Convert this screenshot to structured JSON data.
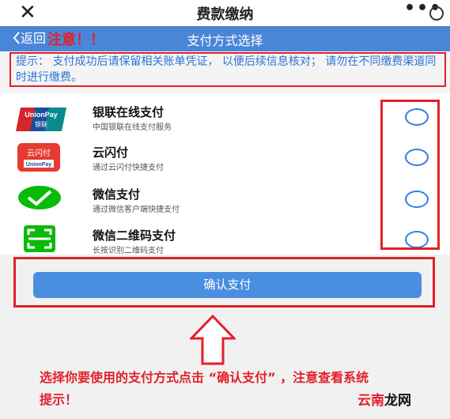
{
  "topbar": {
    "title": "费款缴纳",
    "close_glyph": "✕",
    "more_glyph": "•••"
  },
  "navbar": {
    "back_label": "返回",
    "title": "支付方式选择",
    "note": "注意！！"
  },
  "notice": {
    "text": "提示：  支付成功后请保留相关账单凭证，  以便后续信息核对；  请勿在不同缴费渠道同时进行缴费。"
  },
  "methods": [
    {
      "name": "银联在线支付",
      "desc": "中国银联在线支付服务",
      "icon": "unionpay-logo",
      "logo_text_top": "UnionPay",
      "logo_text_bottom": "银联"
    },
    {
      "name": "云闪付",
      "desc": "通过云闪付快捷支付",
      "icon": "cloud-quickpass-logo",
      "logo_text_top": "云闪付",
      "logo_text_bottom": "UnionPay"
    },
    {
      "name": "微信支付",
      "desc": "通过微信客户端快捷支付",
      "icon": "wechat-pay-logo"
    },
    {
      "name": "微信二维码支付",
      "desc": "长按识别二维码支付",
      "icon": "qr-scan-logo"
    }
  ],
  "confirm": {
    "label": "确认支付"
  },
  "instruction": {
    "text": "选择你要使用的支付方式点击 “确认支付” ，注意查看系统提示！"
  },
  "watermark": {
    "part1": "云南",
    "part2": "龙网"
  },
  "colors": {
    "nav_blue": "#4a86d8",
    "highlight_red": "#e2202a",
    "wechat_green": "#09bb07"
  }
}
